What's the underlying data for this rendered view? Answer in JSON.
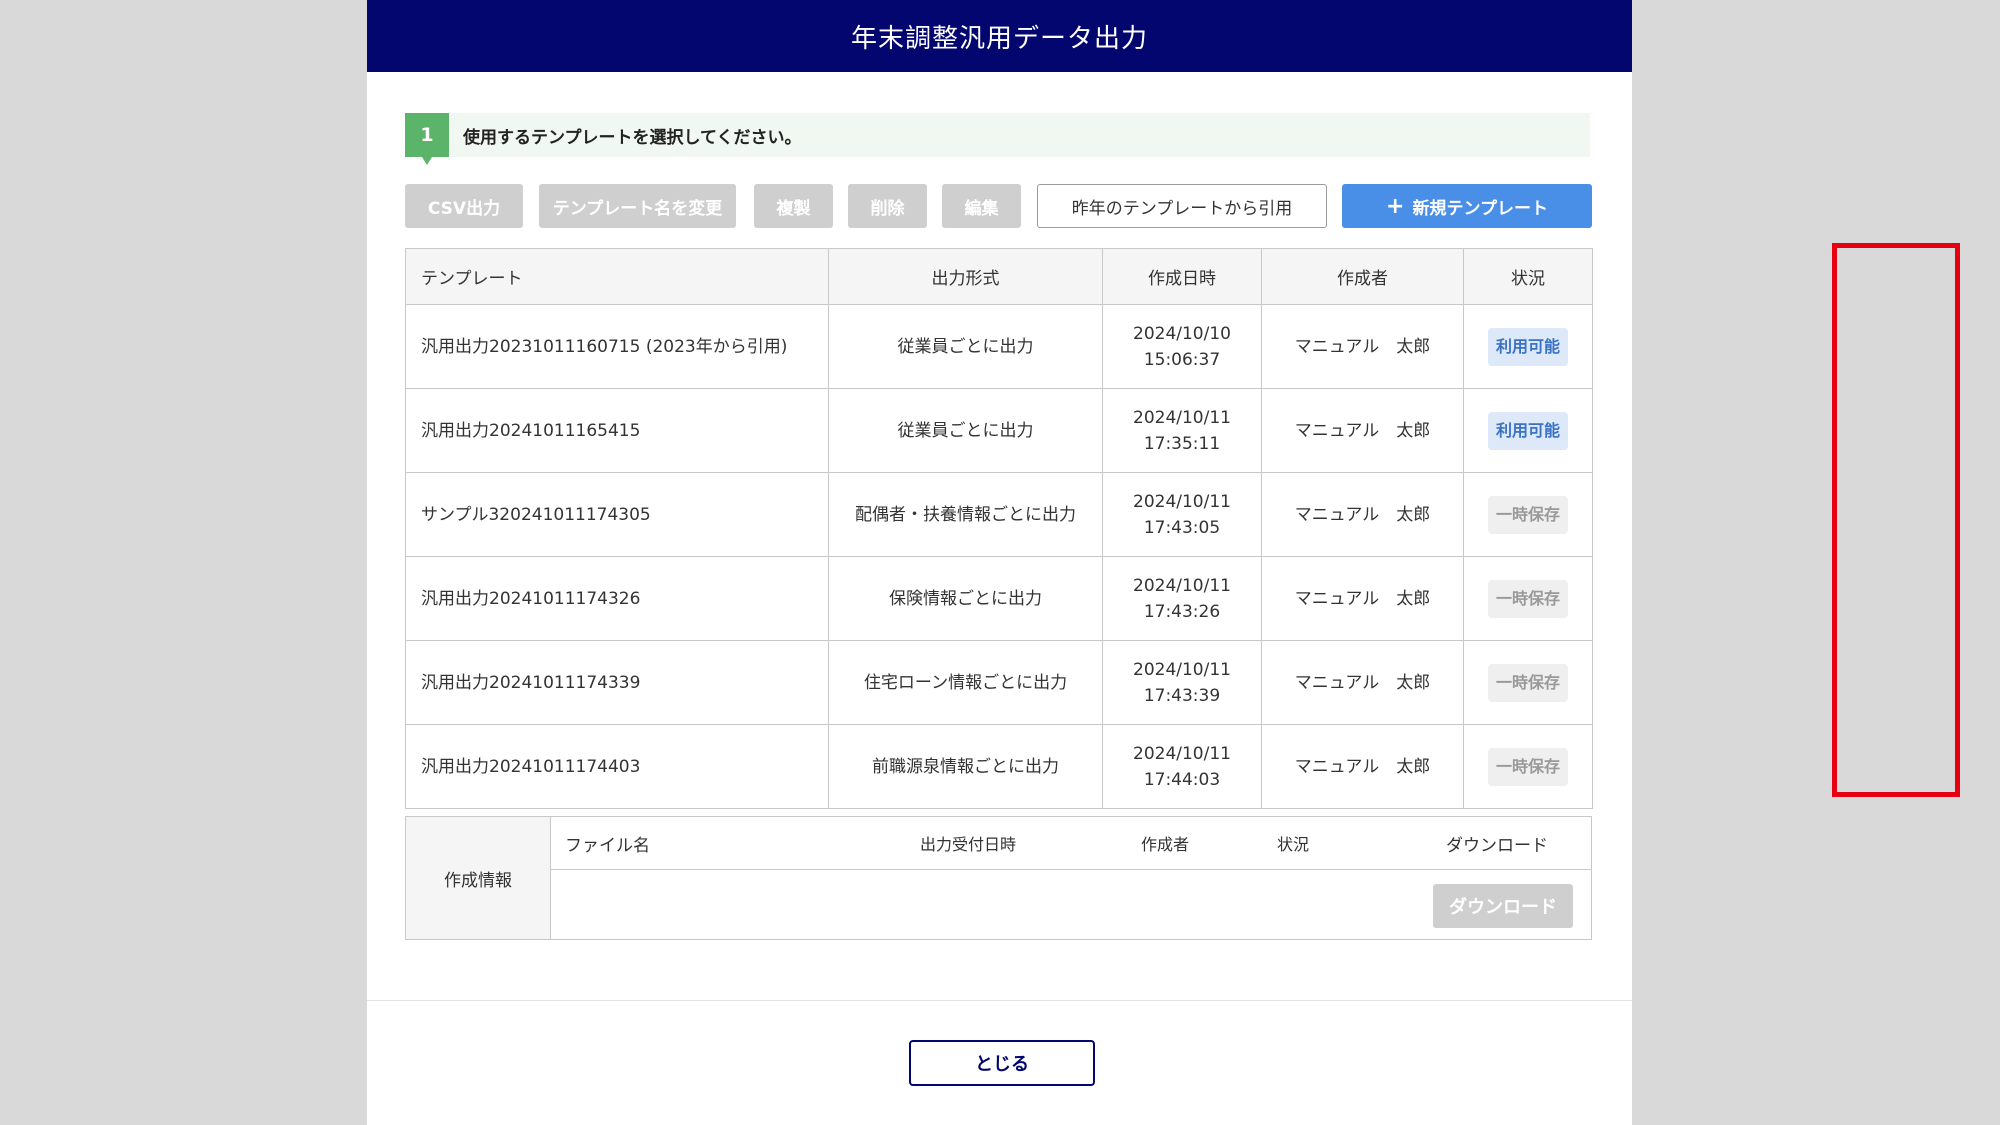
{
  "dialog": {
    "title": "年末調整汎用データ出力"
  },
  "step": {
    "number": "1",
    "text": "使用するテンプレートを選択してください。"
  },
  "toolbar": {
    "csv": "CSV出力",
    "rename": "テンプレート名を変更",
    "duplicate": "複製",
    "delete": "削除",
    "edit": "編集",
    "cite": "昨年のテンプレートから引用",
    "new": "新規テンプレート",
    "new_icon": "+"
  },
  "table": {
    "headers": {
      "template": "テンプレート",
      "format": "出力形式",
      "created": "作成日時",
      "creator": "作成者",
      "status": "状況"
    },
    "rows": [
      {
        "template": "汎用出力20231011160715 (2023年から引用)",
        "format": "従業員ごとに出力",
        "date": "2024/10/10",
        "time": "15:06:37",
        "creator": "マニュアル　太郎",
        "status": "利用可能"
      },
      {
        "template": "汎用出力20241011165415",
        "format": "従業員ごとに出力",
        "date": "2024/10/11",
        "time": "17:35:11",
        "creator": "マニュアル　太郎",
        "status": "利用可能"
      },
      {
        "template": "サンプル320241011174305",
        "format": "配偶者・扶養情報ごとに出力",
        "date": "2024/10/11",
        "time": "17:43:05",
        "creator": "マニュアル　太郎",
        "status": "一時保存"
      },
      {
        "template": "汎用出力20241011174326",
        "format": "保険情報ごとに出力",
        "date": "2024/10/11",
        "time": "17:43:26",
        "creator": "マニュアル　太郎",
        "status": "一時保存"
      },
      {
        "template": "汎用出力20241011174339",
        "format": "住宅ローン情報ごとに出力",
        "date": "2024/10/11",
        "time": "17:43:39",
        "creator": "マニュアル　太郎",
        "status": "一時保存"
      },
      {
        "template": "汎用出力20241011174403",
        "format": "前職源泉情報ごとに出力",
        "date": "2024/10/11",
        "time": "17:44:03",
        "creator": "マニュアル　太郎",
        "status": "一時保存"
      }
    ]
  },
  "info": {
    "label": "作成情報",
    "headers": {
      "filename": "ファイル名",
      "received": "出力受付日時",
      "creator": "作成者",
      "status": "状況",
      "download": "ダウンロード"
    },
    "download_button": "ダウンロード"
  },
  "footer": {
    "close": "とじる"
  },
  "colors": {
    "header_bg": "#03066e",
    "step_green": "#5cb36a",
    "primary_blue": "#4a8fe7",
    "highlight_red": "#e60012"
  }
}
